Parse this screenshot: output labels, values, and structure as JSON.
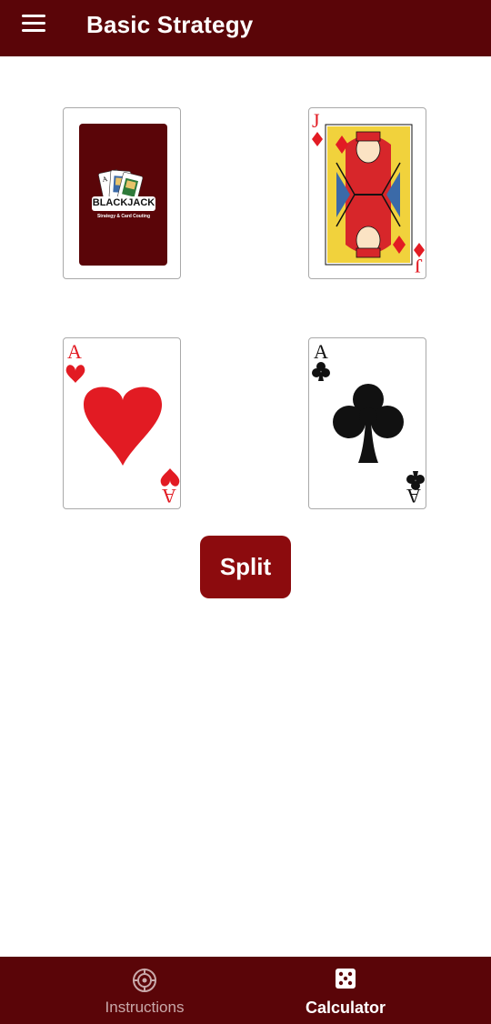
{
  "appbar": {
    "title": "Basic Strategy",
    "menu_icon": "hamburger-menu-icon"
  },
  "cards": {
    "dealer_back": {
      "brand": "BLACKJACK",
      "tagline": "Strategy & Card Couting"
    },
    "dealer_upcard": {
      "rank": "J",
      "suit": "diamonds"
    },
    "player_card_1": {
      "rank": "A",
      "suit": "hearts"
    },
    "player_card_2": {
      "rank": "A",
      "suit": "clubs"
    }
  },
  "action": {
    "label": "Split"
  },
  "bottom_nav": {
    "items": [
      {
        "label": "Instructions",
        "icon": "target-icon",
        "active": false
      },
      {
        "label": "Calculator",
        "icon": "dice-icon",
        "active": true
      }
    ]
  },
  "colors": {
    "primary": "#5a0508",
    "button": "#8c0b0e",
    "red_suit": "#e21b23",
    "black_suit": "#111111"
  }
}
